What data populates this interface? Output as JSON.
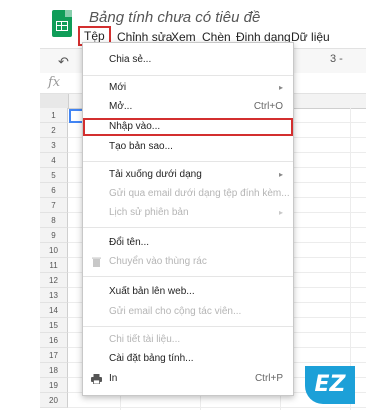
{
  "app": {
    "doc_title": "Bảng tính chưa có tiêu đề"
  },
  "menubar": [
    {
      "label": "Tệp",
      "active": true
    },
    {
      "label": "Chỉnh sửa"
    },
    {
      "label": "Xem"
    },
    {
      "label": "Chèn"
    },
    {
      "label": "Định dạng"
    },
    {
      "label": "Dữ liệu"
    }
  ],
  "toolbar": {
    "right_text": "3 -"
  },
  "formula_bar": {
    "fx_label": "fx"
  },
  "rows": [
    "1",
    "2",
    "3",
    "4",
    "5",
    "6",
    "7",
    "8",
    "9",
    "10",
    "11",
    "12",
    "13",
    "14",
    "15",
    "16",
    "17",
    "18",
    "19",
    "20"
  ],
  "file_menu": {
    "share": "Chia sẻ...",
    "new": "Mới",
    "open": "Mở...",
    "open_shortcut": "Ctrl+O",
    "import": "Nhập vào...",
    "make_copy": "Tạo bản sao...",
    "download_as": "Tải xuống dưới dạng",
    "email_attachment": "Gửi qua email dưới dạng tệp đính kèm...",
    "version_history": "Lịch sử phiên bản",
    "rename": "Đổi tên...",
    "move_to_trash": "Chuyển vào thùng rác",
    "publish_web": "Xuất bản lên web...",
    "email_collaborators": "Gửi email cho cộng tác viên...",
    "document_details": "Chi tiết tài liệu...",
    "spreadsheet_settings": "Cài đặt bảng tính...",
    "print": "In",
    "print_shortcut": "Ctrl+P",
    "arrow": "▸"
  },
  "watermark": {
    "text": "EZ"
  },
  "colors": {
    "highlight": "#d32f2f",
    "selection": "#4285f4",
    "brand": "#0f9d58"
  }
}
